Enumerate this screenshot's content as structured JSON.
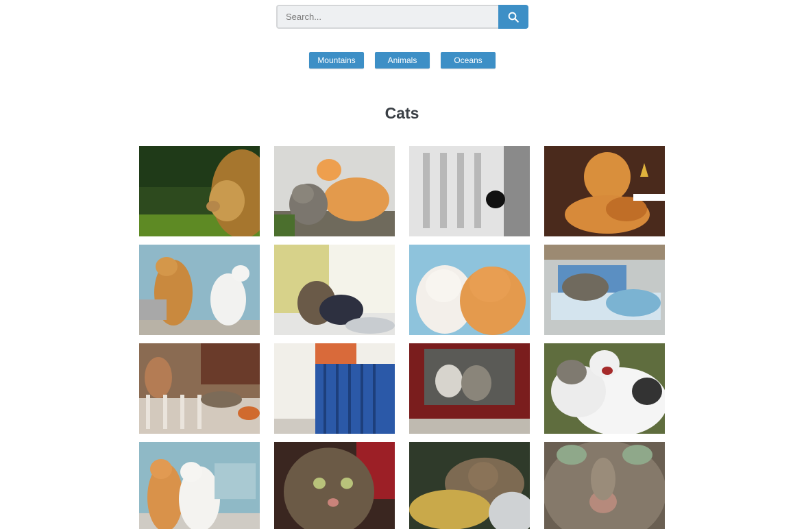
{
  "search": {
    "placeholder": "Search...",
    "icon": "search-icon"
  },
  "categories": [
    "Mountains",
    "Animals",
    "Oceans"
  ],
  "gallery": {
    "title": "Cats"
  },
  "colors": {
    "accent": "#3d8fc6",
    "title": "#3a3f45"
  }
}
